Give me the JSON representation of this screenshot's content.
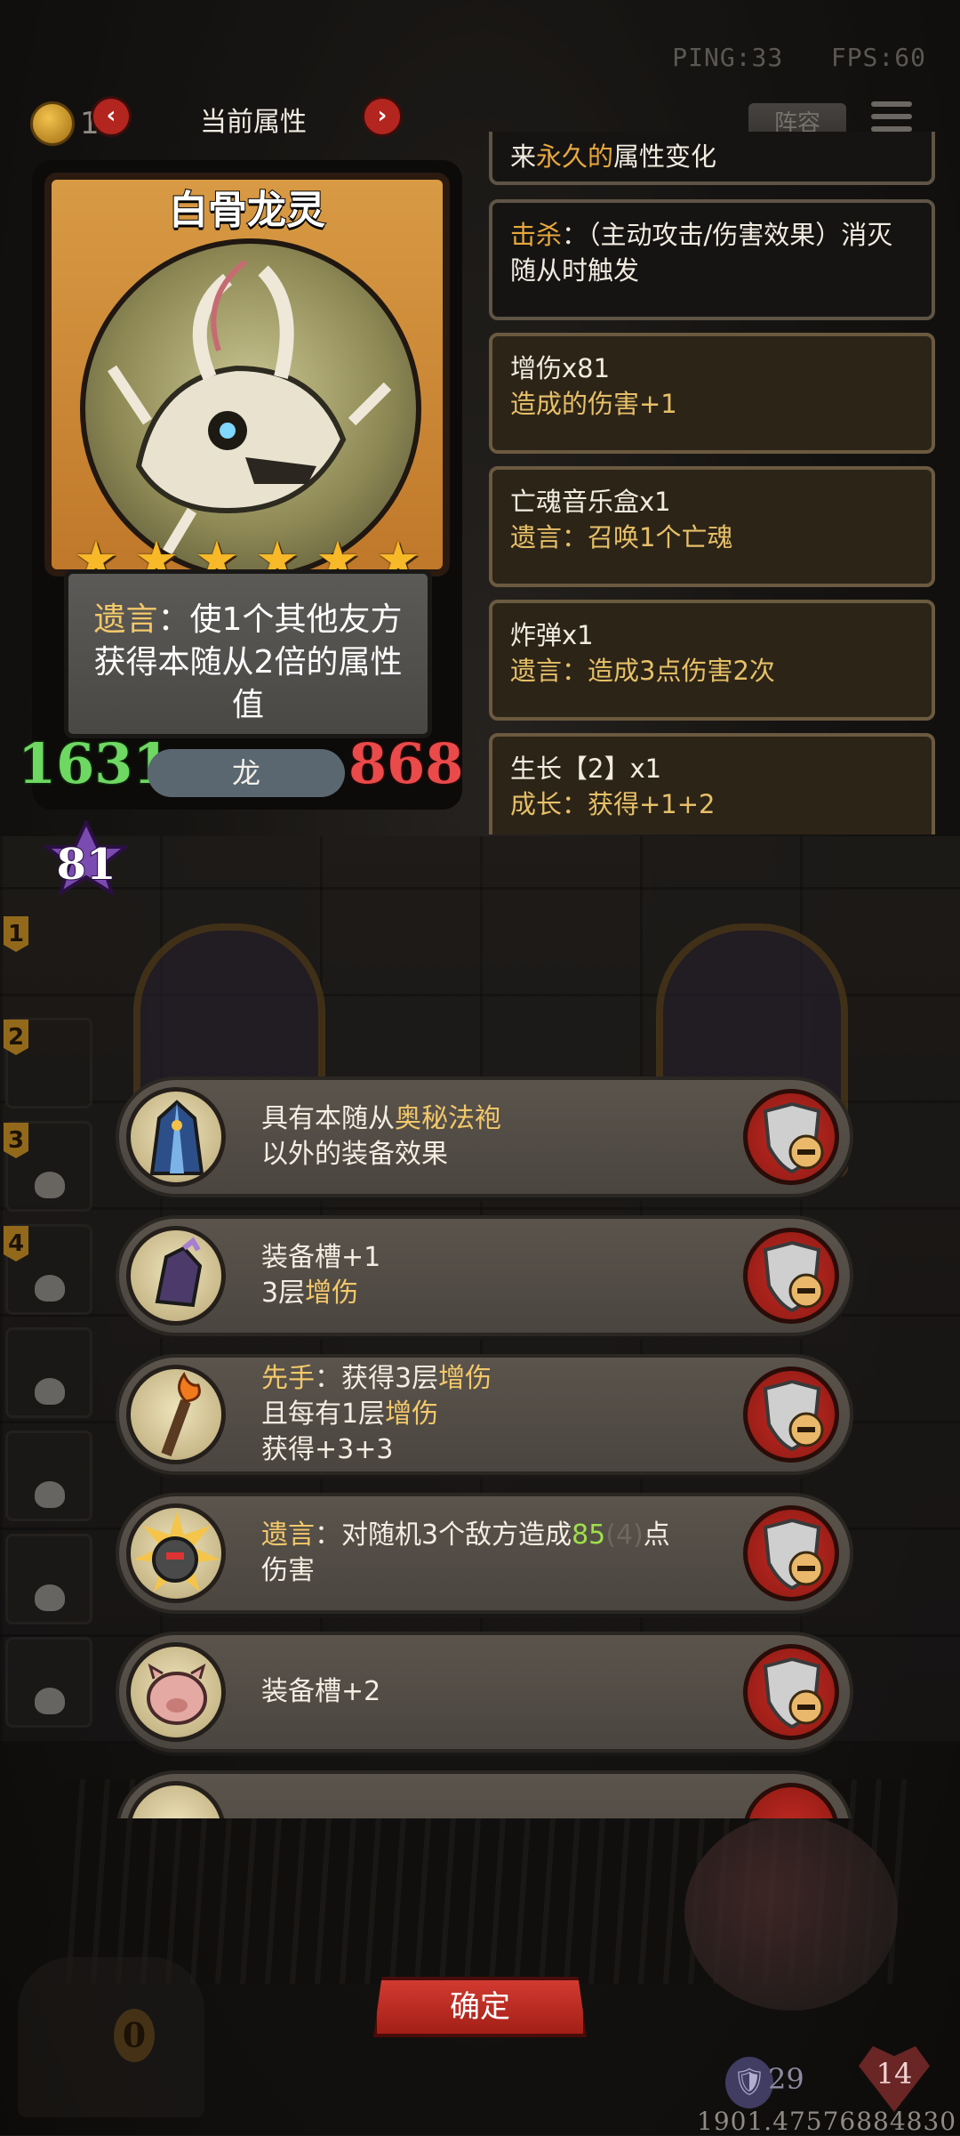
{
  "status": {
    "ping": "PING:33",
    "fps": "FPS:60"
  },
  "gold": "1 7",
  "header": {
    "title": "当前属性",
    "lineup_label": "阵容"
  },
  "card": {
    "name": "白骨龙灵",
    "stars": 6,
    "desc_kw": "遗言",
    "desc_rest": "：使1个其他友方获得本随从2倍的属性值",
    "attack": "1631",
    "health": "868",
    "tribe": "龙",
    "level": "81"
  },
  "attributes": [
    {
      "line1_pre": "来",
      "line1_kw": "永久的",
      "line1_post": "属性变化",
      "line2": ""
    },
    {
      "line1_kw": "击杀",
      "line1_post": "：（主动攻击/伤害效果）消灭",
      "line2": "随从时触发"
    },
    {
      "title": "增伤x81",
      "sub": "造成的伤害+1"
    },
    {
      "title": "亡魂音乐盒x1",
      "sub": "遗言：召唤1个亡魂"
    },
    {
      "title": "炸弹x1",
      "sub": "遗言：造成3点伤害2次"
    },
    {
      "title": "生长【2】x1",
      "sub": "成长：获得+1+2"
    }
  ],
  "slots": [
    "1",
    "2",
    "3",
    "4"
  ],
  "equipment": [
    {
      "icon": "mystic-robe-icon",
      "l1_pre": "具有本随从",
      "l1_kw": "奥秘法袍",
      "l2": "以外的装备效果"
    },
    {
      "icon": "gauntlet-icon",
      "l1": "装备槽+1",
      "l2_pre": "3层",
      "l2_kw": "增伤"
    },
    {
      "icon": "torch-icon",
      "l1_kw": "先手",
      "l1_mid": "：获得3层",
      "l1_kw2": "增伤",
      "l2_pre": "且每有1层",
      "l2_kw": "增伤",
      "l3": "获得+3+3"
    },
    {
      "icon": "bomb-icon",
      "l1_kw": "遗言",
      "l1_mid": "：对随机3个敌方造成",
      "l1_val": "85",
      "l1_extra": "(4)",
      "l1_post": "点",
      "l2": "伤害"
    },
    {
      "icon": "pig-icon",
      "l1": "装备槽+2"
    }
  ],
  "chest_count": "0",
  "confirm_label": "确定",
  "hero_stats": {
    "armor": "29",
    "health": "14"
  },
  "coords": "1901.47576884830"
}
